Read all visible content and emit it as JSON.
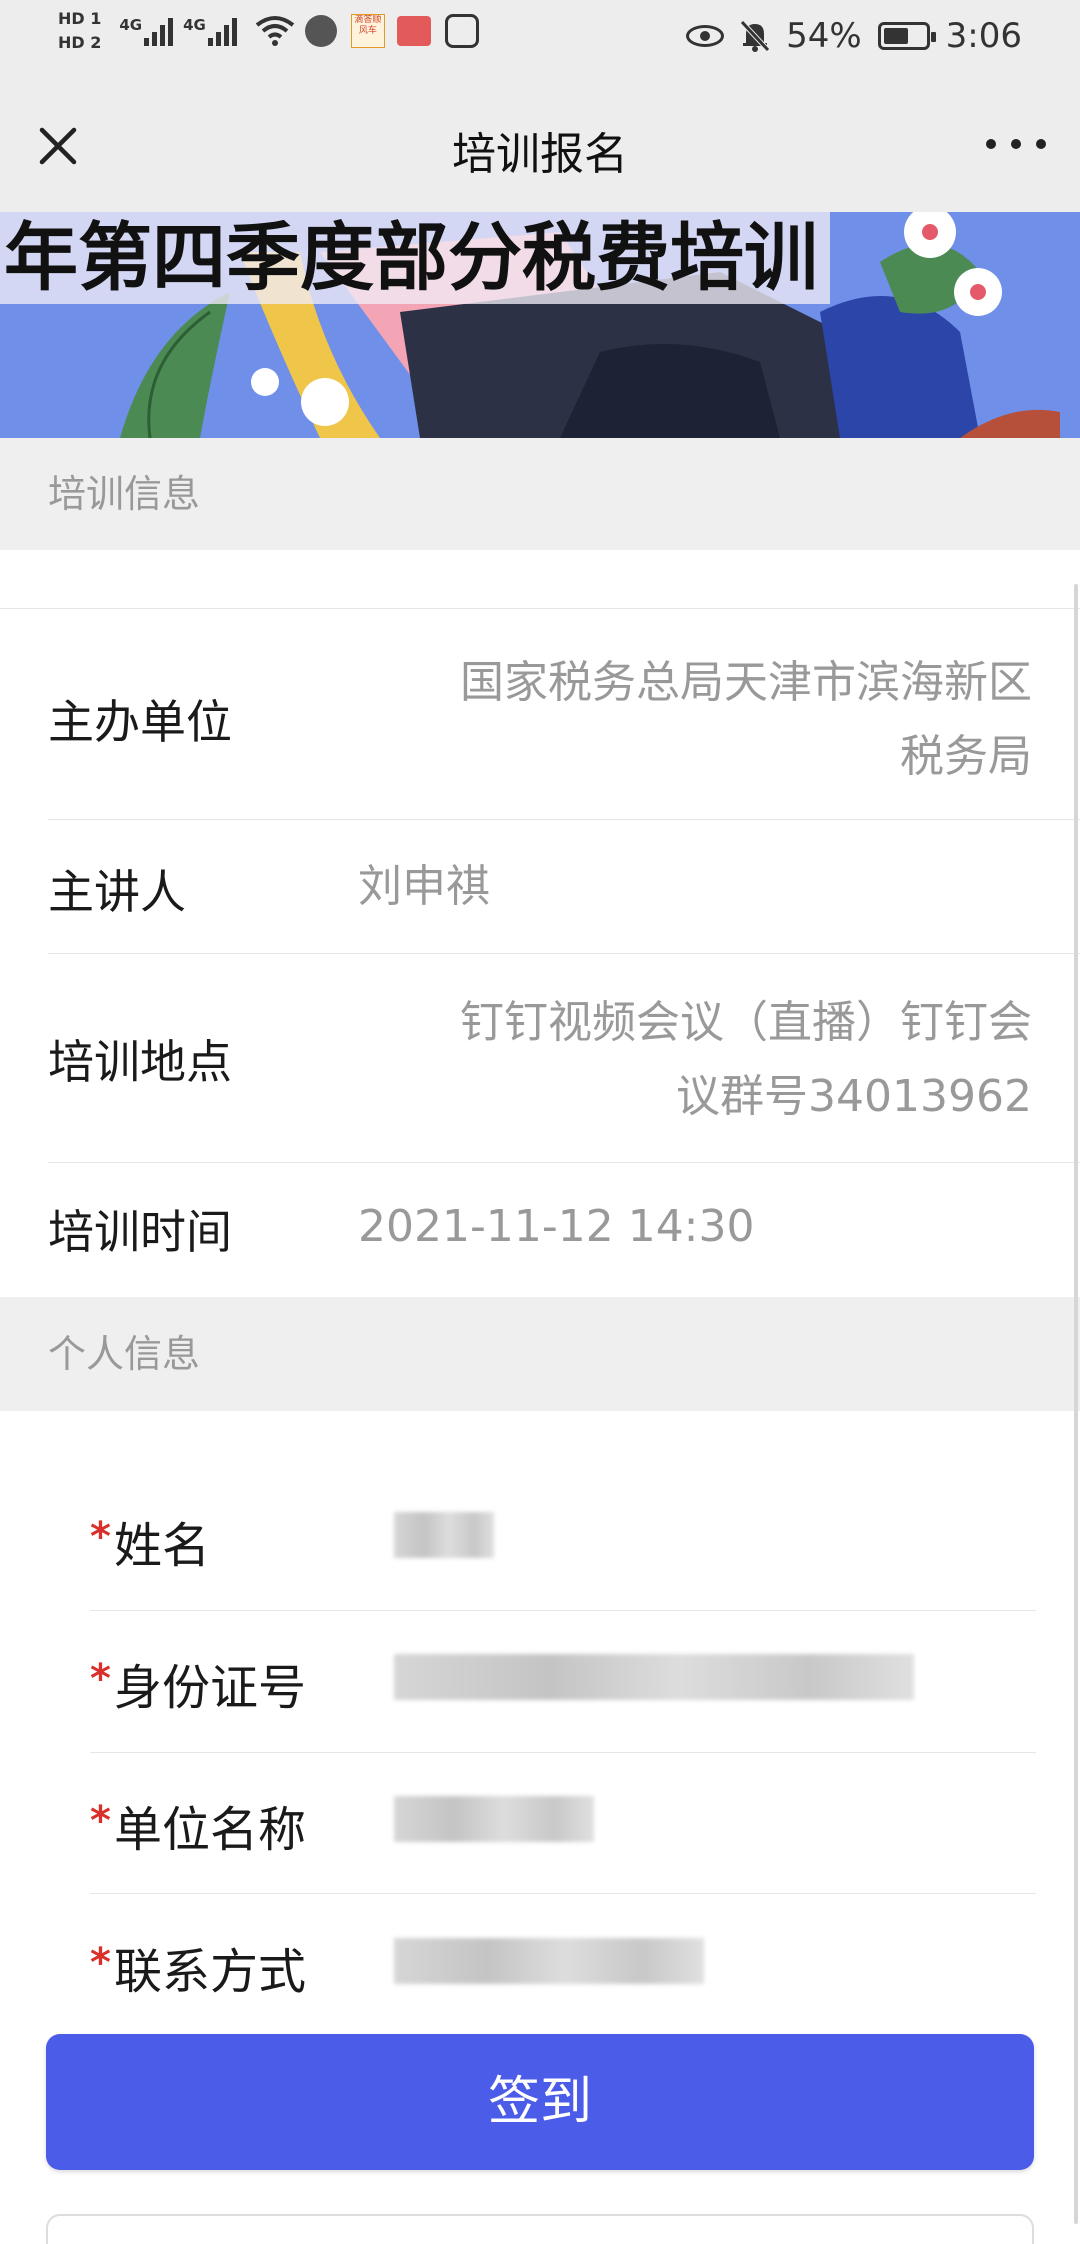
{
  "status_bar": {
    "hd1": "HD 1",
    "hd2": "HD 2",
    "sim1_tag": "4G",
    "sim2_tag": "4G",
    "news_app": "滴答顺风车",
    "battery_percent": "54%",
    "time": "3:06"
  },
  "nav": {
    "title": "培训报名"
  },
  "banner": {
    "title": "年第四季度部分税费培训"
  },
  "training_section": {
    "header": "培训信息",
    "rows": [
      {
        "label": "主办单位",
        "value_line1": "国家税务总局天津市滨海新区",
        "value_line2": "税务局"
      },
      {
        "label": "主讲人",
        "value": "刘申祺"
      },
      {
        "label": "培训地点",
        "value_line1": "钉钉视频会议（直播）钉钉会",
        "value_line2": "议群号34013962"
      },
      {
        "label": "培训时间",
        "value": "2021-11-12 14:30"
      }
    ]
  },
  "personal_section": {
    "header": "个人信息",
    "required_mark": "*",
    "fields": [
      {
        "label": "姓名"
      },
      {
        "label": "身份证号"
      },
      {
        "label": "单位名称"
      },
      {
        "label": "联系方式"
      }
    ]
  },
  "actions": {
    "submit_label": "签到"
  },
  "colors": {
    "primary_button": "#4b5ce8",
    "required": "#d9302b",
    "banner_bg": "#6d8be6"
  },
  "icons": [
    "close-icon",
    "more-icon",
    "eye-icon",
    "bell-mute-icon",
    "battery-icon",
    "wifi-icon"
  ]
}
